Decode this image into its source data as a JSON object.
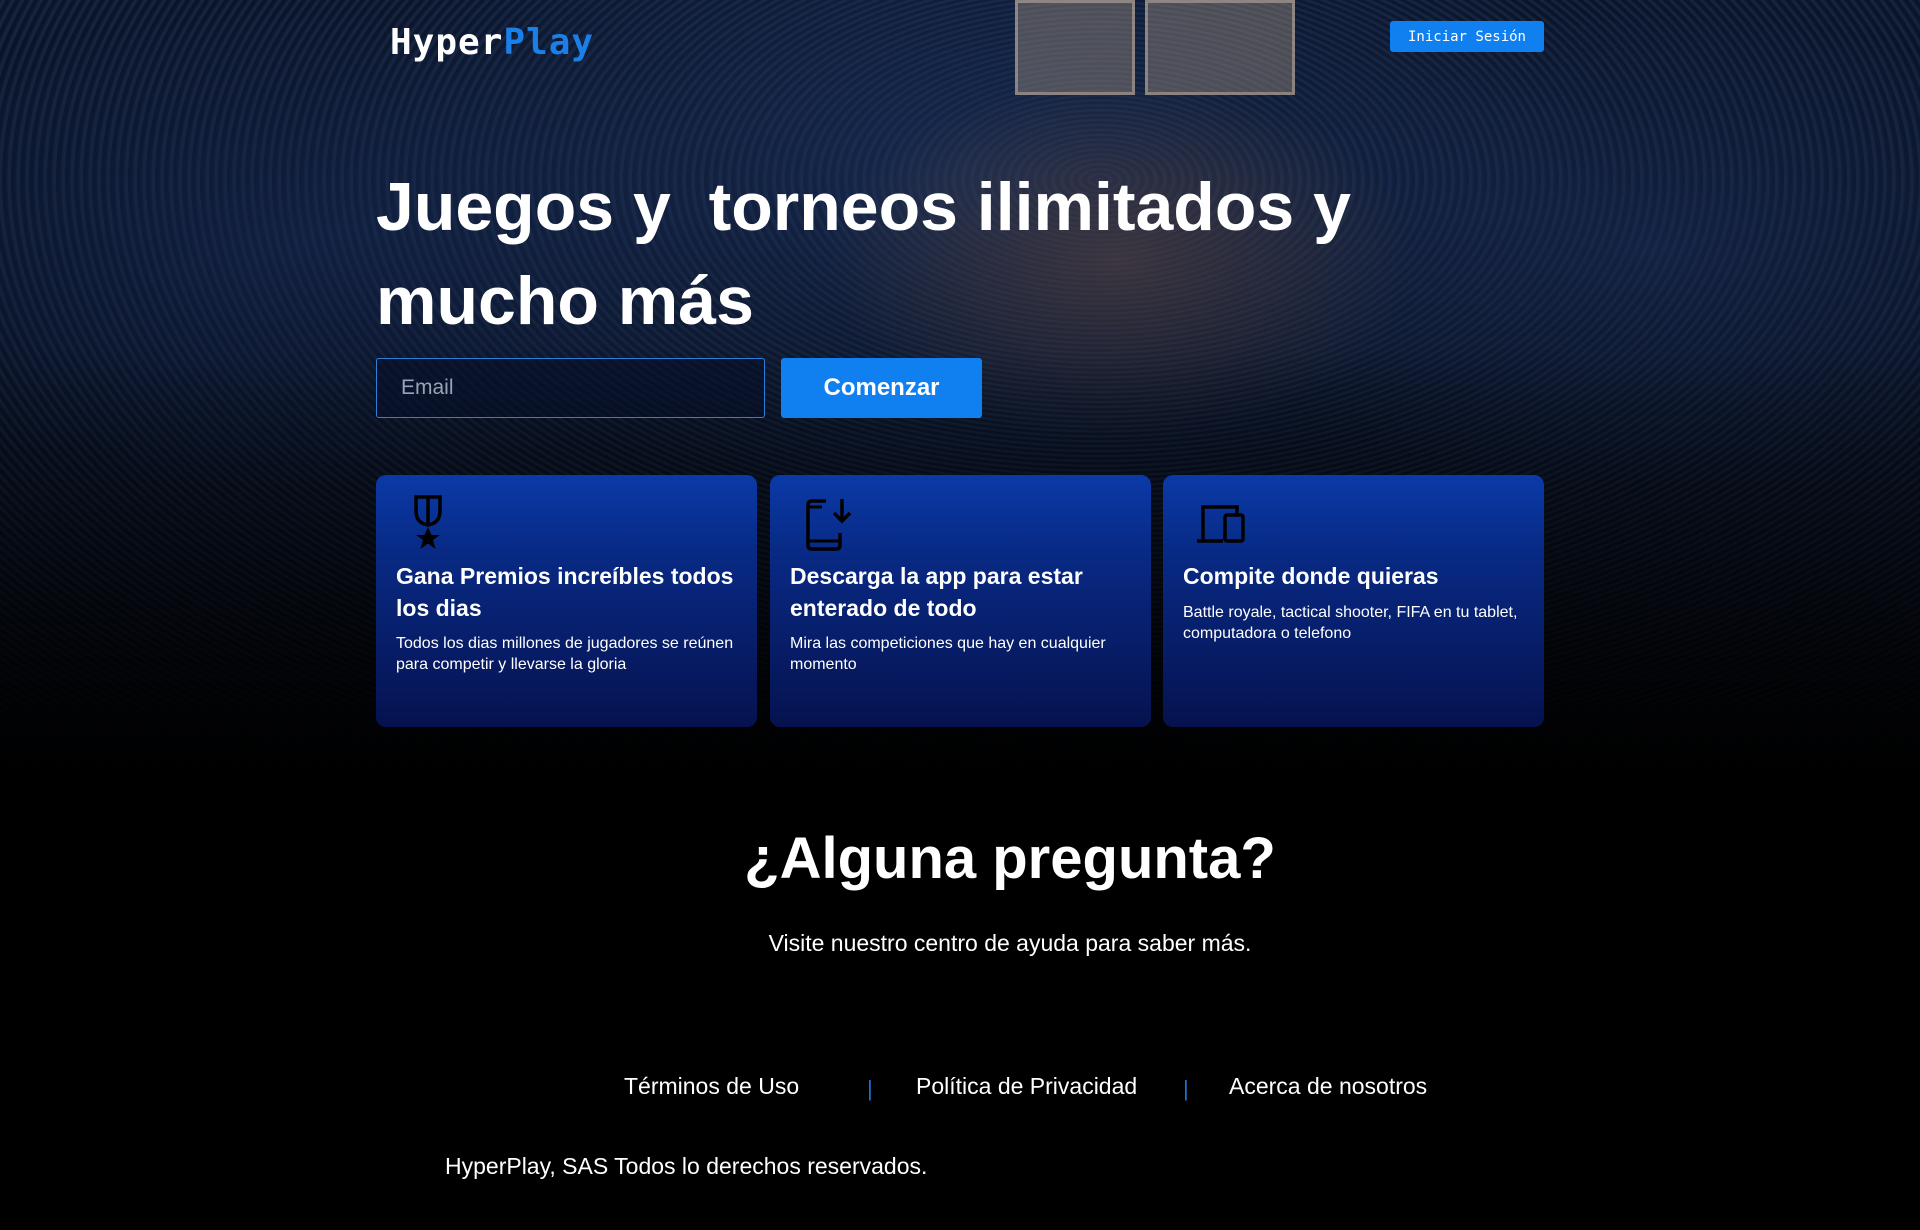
{
  "header": {
    "logo_part_a": "Hyper",
    "logo_part_b": "Play",
    "signin_label": "Iniciar Sesión"
  },
  "hero": {
    "title": "Juegos y  torneos ilimitados y mucho más",
    "email_placeholder": "Email",
    "email_value": "",
    "start_label": "Comenzar"
  },
  "features": [
    {
      "icon": "medal-star-icon",
      "title": "Gana Premios increíbles todos los dias",
      "text": "Todos los dias millones de jugadores se reúnen para competir y llevarse la gloria"
    },
    {
      "icon": "phone-download-icon",
      "title": "Descarga la app para estar enterado de todo",
      "text": "Mira las competiciones que hay en cualquier momento"
    },
    {
      "icon": "devices-icon",
      "title": "Compite donde quieras",
      "text": "Battle royale, tactical shooter, FIFA en tu tablet, computadora o telefono"
    }
  ],
  "questions": {
    "title": "¿Alguna pregunta?",
    "text": "Visite nuestro centro de ayuda para saber más."
  },
  "footer": {
    "links": [
      "Términos de Uso",
      "Política de Privacidad",
      "Acerca de nosotros"
    ],
    "separator": "|",
    "copyright": "HyperPlay, SAS Todos lo derechos reservados."
  },
  "colors": {
    "accent": "#1080f0",
    "background": "#000000",
    "card_top": "#0a3aa8",
    "card_bottom": "#06124f"
  }
}
